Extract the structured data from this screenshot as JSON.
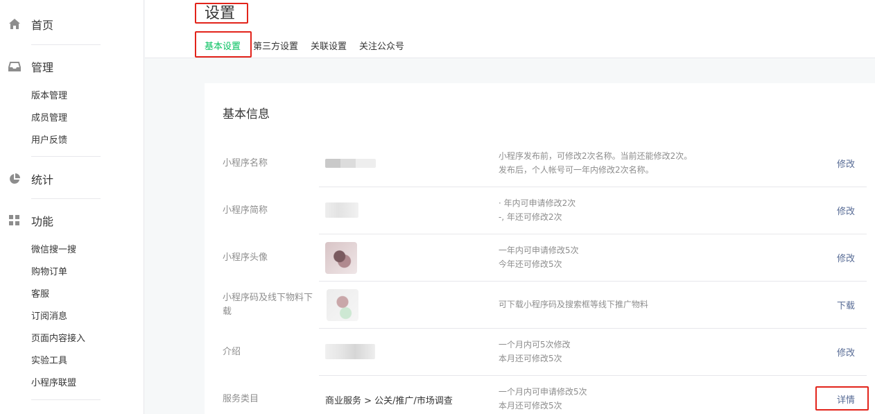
{
  "sidebar": {
    "groups": [
      {
        "title": "首页",
        "icon": "home-icon",
        "items": []
      },
      {
        "title": "管理",
        "icon": "inbox-icon",
        "items": [
          "版本管理",
          "成员管理",
          "用户反馈"
        ]
      },
      {
        "title": "统计",
        "icon": "pie-chart-icon",
        "items": []
      },
      {
        "title": "功能",
        "icon": "grid-icon",
        "items": [
          "微信搜一搜",
          "购物订单",
          "客服",
          "订阅消息",
          "页面内容接入",
          "实验工具",
          "小程序联盟"
        ]
      }
    ]
  },
  "header": {
    "title": "设置",
    "tabs": [
      "基本设置",
      "第三方设置",
      "关联设置",
      "关注公众号"
    ],
    "active_tab": "基本设置"
  },
  "card": {
    "title": "基本信息",
    "rows": [
      {
        "label": "小程序名称",
        "value": "",
        "desc1": "小程序发布前，可修改2次名称。当前还能修改2次。",
        "desc2": "发布后，个人帐号可一年内修改2次名称。",
        "action": "修改"
      },
      {
        "label": "小程序简称",
        "value": "",
        "desc1": "· 年内可申请修改2次",
        "desc2": "-, 年还可修改2次",
        "action": "修改"
      },
      {
        "label": "小程序头像",
        "value": "",
        "desc1": "一年内可申请修改5次",
        "desc2": "今年还可修改5次",
        "action": "修改"
      },
      {
        "label": "小程序码及线下物料下载",
        "value": "",
        "desc1": "可下载小程序码及搜索框等线下推广物料",
        "desc2": "",
        "action": "下载"
      },
      {
        "label": "介绍",
        "value": "",
        "desc1": "一个月内可5次修改",
        "desc2": "本月还可修改5次",
        "action": "修改"
      },
      {
        "label": "服务类目",
        "value": "商业服务 > 公关/推广/市场调查",
        "desc1": "一个月内可申请修改5次",
        "desc2": "本月还可修改5次",
        "action": "详情"
      }
    ]
  },
  "colors": {
    "accent": "#07c160",
    "link": "#576b95",
    "highlight": "#e2231a"
  }
}
